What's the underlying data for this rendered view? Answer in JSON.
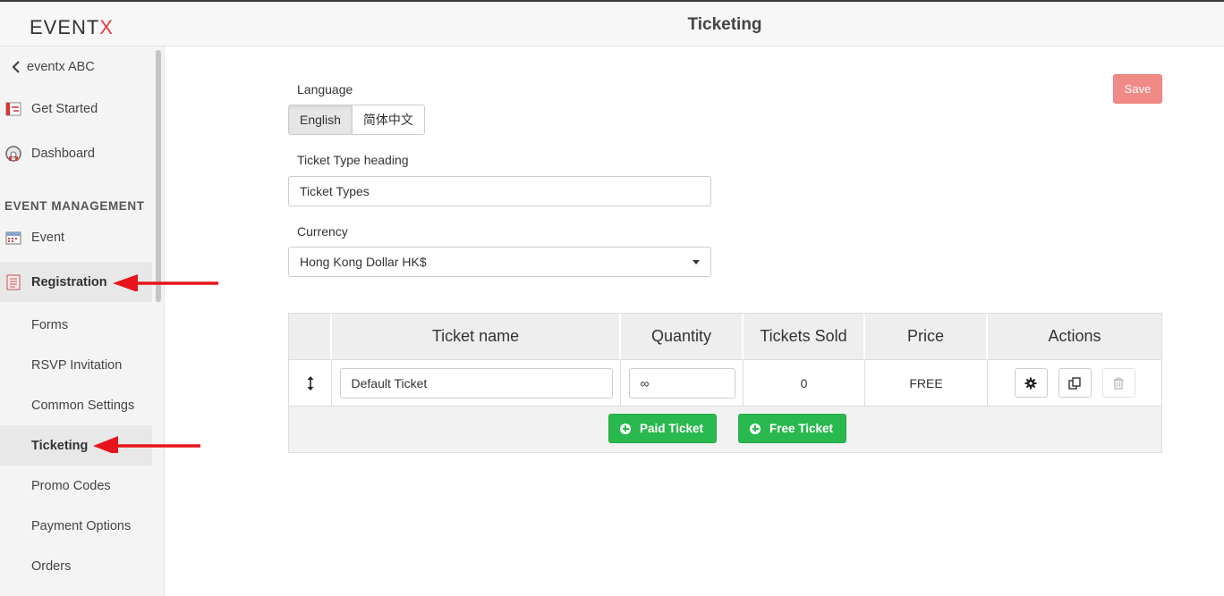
{
  "header": {
    "logo_main": "EVENT",
    "logo_x": "X",
    "title": "Ticketing"
  },
  "sidebar": {
    "back_label": "eventx ABC",
    "items_top": [
      {
        "label": "Get Started",
        "icon": "get-started-icon"
      },
      {
        "label": "Dashboard",
        "icon": "dashboard-icon"
      }
    ],
    "section_title": "EVENT MANAGEMENT",
    "event_label": "Event",
    "registration_label": "Registration",
    "sub_items": [
      "Forms",
      "RSVP Invitation",
      "Common Settings",
      "Ticketing",
      "Promo Codes",
      "Payment Options",
      "Orders"
    ],
    "active_item": "Ticketing"
  },
  "form": {
    "language_label": "Language",
    "languages": [
      "English",
      "简体中文"
    ],
    "selected_language": "English",
    "heading_label": "Ticket Type heading",
    "heading_value": "Ticket Types",
    "currency_label": "Currency",
    "currency_value": "Hong Kong Dollar HK$",
    "save_label": "Save"
  },
  "table": {
    "columns": [
      "Ticket name",
      "Quantity",
      "Tickets Sold",
      "Price",
      "Actions"
    ],
    "rows": [
      {
        "name": "Default Ticket",
        "quantity": "∞",
        "sold": "0",
        "price": "FREE"
      }
    ],
    "paid_ticket_label": "Paid Ticket",
    "free_ticket_label": "Free Ticket"
  },
  "colors": {
    "accent_red": "#e8383d",
    "save_button": "#f08a87",
    "green_button": "#2ab94f",
    "annotation_arrow": "#e8141b"
  }
}
